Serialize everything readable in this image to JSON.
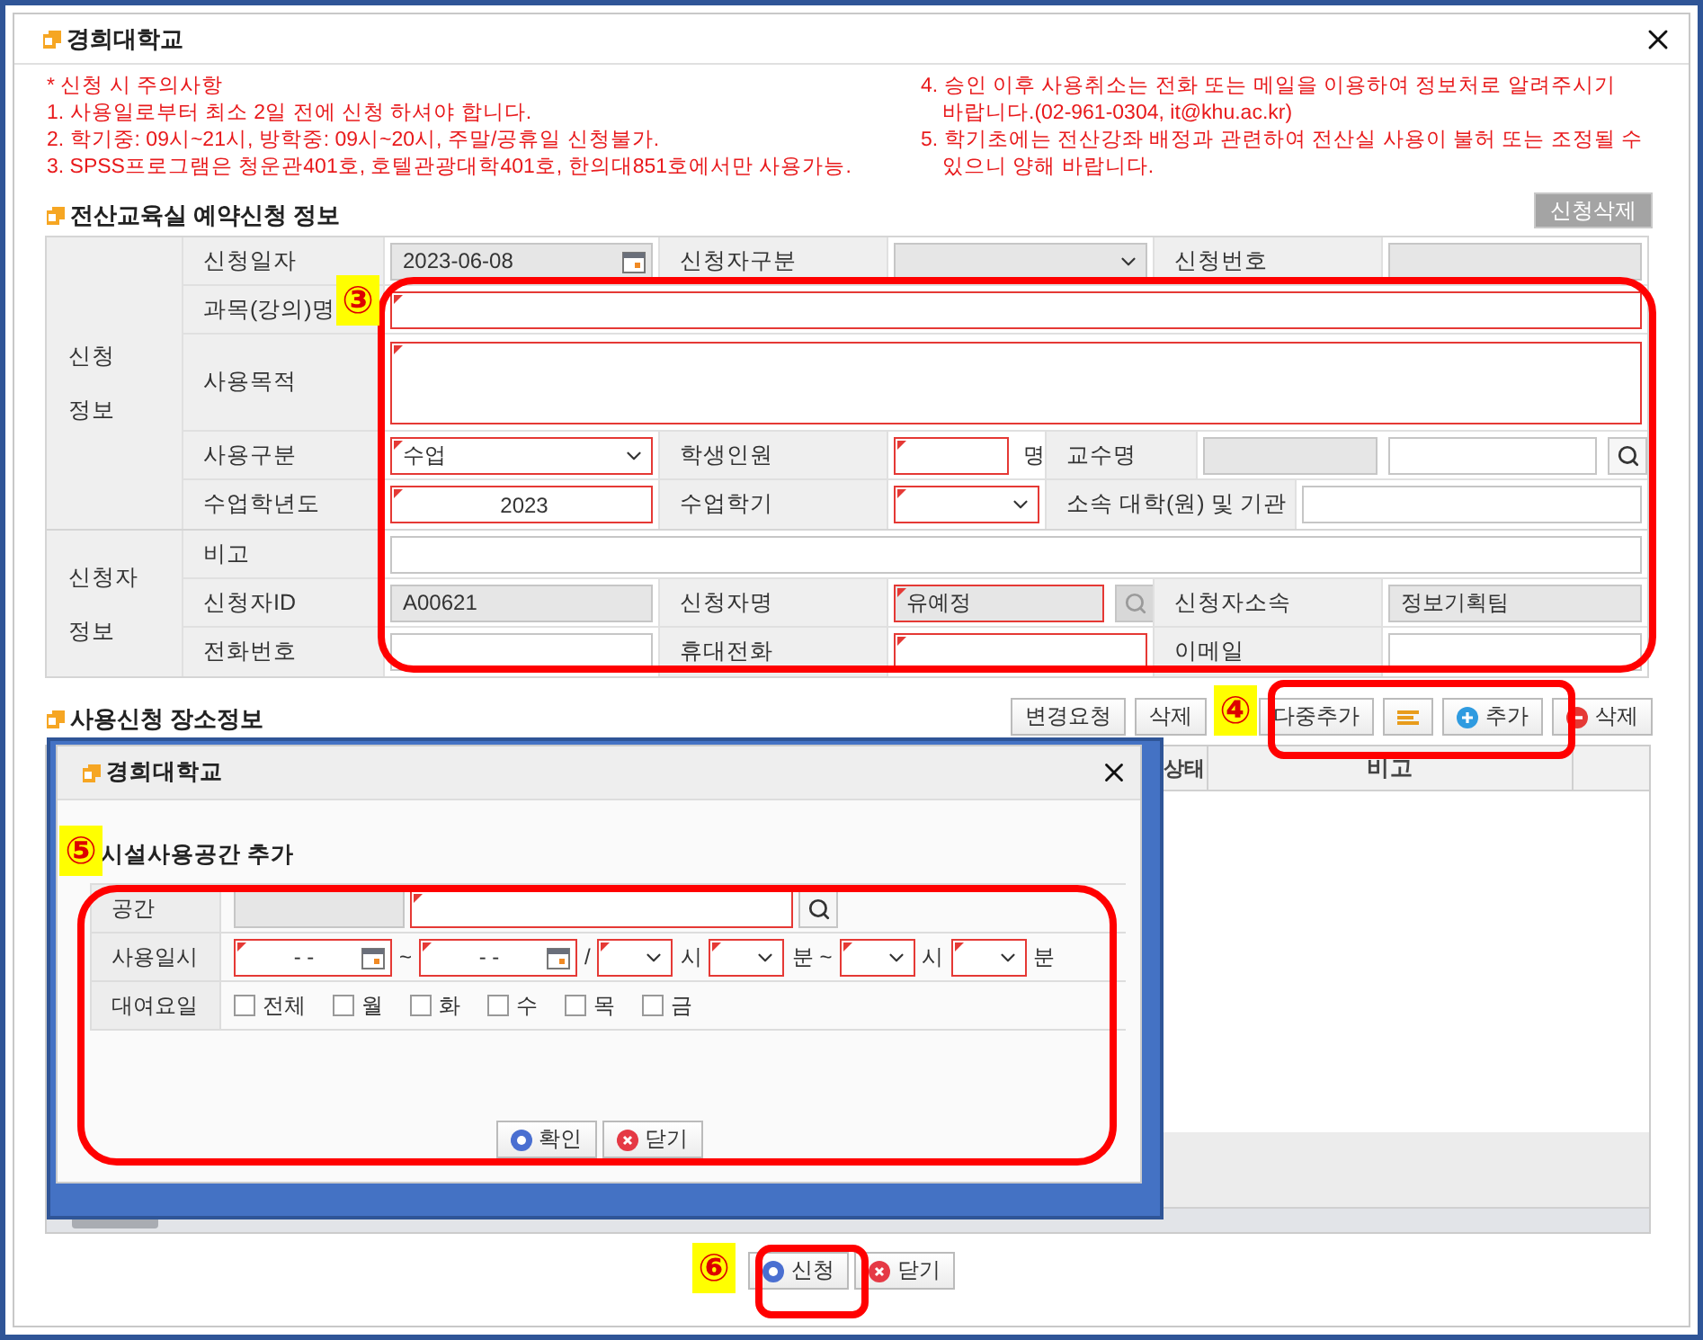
{
  "dialog": {
    "title": "경희대학교"
  },
  "notes_left": [
    "* 신청 시 주의사항",
    "1. 사용일로부터 최소 2일 전에 신청 하셔야 합니다.",
    "2. 학기중: 09시~21시, 방학중: 09시~20시, 주말/공휴일 신청불가.",
    "3. SPSS프로그램은 청운관401호, 호텔관광대학401호, 한의대851호에서만 사용가능."
  ],
  "notes_right": [
    "4. 승인 이후 사용취소는 전화 또는 메일을 이용하여 정보처로 알려주시기 바랍니다.(02-961-0304, it@khu.ac.kr)",
    "5. 학기초에는 전산강좌 배정과 관련하여 전산실 사용이 불허 또는 조정될 수 있으니 양해 바랍니다."
  ],
  "reservation": {
    "title": "전산교육실 예약신청 정보",
    "delete_button": {
      "label": "신청삭제",
      "disabled": true
    },
    "groups": [
      {
        "label": "신청 정보",
        "rows": [
          [
            {
              "kind": "label",
              "text": "신청일자"
            },
            {
              "kind": "date",
              "value": "2023-06-08",
              "readonly": true
            },
            {
              "kind": "label",
              "text": "신청자구분"
            },
            {
              "kind": "select",
              "readonly": true
            },
            {
              "kind": "label",
              "text": "신청번호"
            },
            {
              "kind": "input",
              "readonly": true
            }
          ],
          [
            {
              "kind": "label",
              "text": "과목(강의)명"
            },
            {
              "kind": "input",
              "required": true
            }
          ],
          [
            {
              "kind": "label",
              "text": "사용목적"
            },
            {
              "kind": "textarea",
              "required": true
            }
          ],
          [
            {
              "kind": "label",
              "text": "사용구분"
            },
            {
              "kind": "select",
              "value": "수업",
              "required": true
            },
            {
              "kind": "label",
              "text": "학생인원"
            },
            {
              "kind": "input",
              "required": true
            },
            {
              "kind": "unit",
              "text": "명"
            },
            {
              "kind": "label",
              "text": "교수명"
            },
            {
              "kind": "input",
              "readonly": true
            },
            {
              "kind": "input"
            },
            {
              "kind": "search",
              "disabled": false
            }
          ],
          [
            {
              "kind": "label",
              "text": "수업학년도"
            },
            {
              "kind": "input",
              "value": "2023",
              "required": true
            },
            {
              "kind": "label",
              "text": "수업학기"
            },
            {
              "kind": "select",
              "required": true
            },
            {
              "kind": "label",
              "text": "소속 대학(원) 및 기관"
            },
            {
              "kind": "input"
            }
          ]
        ]
      },
      {
        "label": "신청자 정보",
        "rows": [
          [
            {
              "kind": "label",
              "text": "비고"
            },
            {
              "kind": "input"
            }
          ],
          [
            {
              "kind": "label",
              "text": "신청자ID"
            },
            {
              "kind": "input",
              "value": "A00621",
              "readonly": true
            },
            {
              "kind": "label",
              "text": "신청자명"
            },
            {
              "kind": "input",
              "value": "유예정",
              "readonly": true,
              "required": true
            },
            {
              "kind": "search",
              "disabled": true
            },
            {
              "kind": "label",
              "text": "신청자소속"
            },
            {
              "kind": "input",
              "value": "정보기획팀",
              "readonly": true
            }
          ],
          [
            {
              "kind": "label",
              "text": "전화번호"
            },
            {
              "kind": "input"
            },
            {
              "kind": "label",
              "text": "휴대전화"
            },
            {
              "kind": "input",
              "required": true
            },
            {
              "kind": "label",
              "text": "이메일"
            },
            {
              "kind": "input"
            }
          ]
        ]
      }
    ]
  },
  "places": {
    "title": "사용신청 장소정보",
    "buttons": [
      {
        "kind": "text",
        "label": "변경요청"
      },
      {
        "kind": "text",
        "label": "삭제"
      },
      {
        "kind": "text",
        "label": "다중추가"
      },
      {
        "kind": "sort"
      },
      {
        "kind": "add",
        "label": "추가"
      },
      {
        "kind": "remove",
        "label": "삭제"
      }
    ],
    "columns": [
      "상태",
      "비고"
    ]
  },
  "popup": {
    "title": "경희대학교",
    "heading": "시설사용공간 추가",
    "rows": [
      {
        "label": "공간",
        "items": [
          {
            "kind": "input",
            "readonly": true
          },
          {
            "kind": "input",
            "required": true
          },
          {
            "kind": "search",
            "disabled": false
          }
        ]
      },
      {
        "label": "사용일시",
        "items": [
          {
            "kind": "date",
            "value": "- -",
            "required": true
          },
          {
            "kind": "text",
            "text": "~"
          },
          {
            "kind": "date",
            "value": "- -",
            "required": true
          },
          {
            "kind": "text",
            "text": "/"
          },
          {
            "kind": "select",
            "required": true
          },
          {
            "kind": "text",
            "text": "시"
          },
          {
            "kind": "select",
            "required": true
          },
          {
            "kind": "text",
            "text": "분 ~"
          },
          {
            "kind": "select",
            "required": true
          },
          {
            "kind": "text",
            "text": "시"
          },
          {
            "kind": "select",
            "required": true
          },
          {
            "kind": "text",
            "text": "분"
          }
        ]
      },
      {
        "label": "대여요일",
        "items": [
          {
            "kind": "check",
            "label": "전체",
            "checked": false
          },
          {
            "kind": "check",
            "label": "월",
            "checked": false
          },
          {
            "kind": "check",
            "label": "화",
            "checked": false
          },
          {
            "kind": "check",
            "label": "수",
            "checked": false
          },
          {
            "kind": "check",
            "label": "목",
            "checked": false
          },
          {
            "kind": "check",
            "label": "금",
            "checked": false
          }
        ]
      }
    ],
    "buttons": [
      {
        "kind": "ok",
        "label": "확인"
      },
      {
        "kind": "close",
        "label": "닫기"
      }
    ]
  },
  "footer_buttons": [
    {
      "kind": "ok",
      "label": "신청"
    },
    {
      "kind": "close",
      "label": "닫기"
    }
  ],
  "callouts": [
    {
      "label": "③"
    },
    {
      "label": "④"
    },
    {
      "label": "⑤"
    },
    {
      "label": "⑥"
    }
  ]
}
